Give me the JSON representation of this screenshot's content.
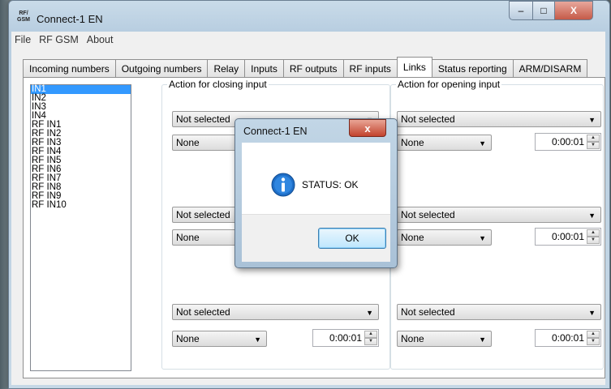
{
  "window": {
    "title": "Connect-1 EN",
    "app_icon_text": "RF/ GSM"
  },
  "menu": [
    "File",
    "RF GSM",
    "About"
  ],
  "tabs": [
    "Incoming numbers",
    "Outgoing numbers",
    "Relay",
    "Inputs",
    "RF outputs",
    "RF inputs",
    "Links",
    "Status reporting",
    "ARM/DISARM"
  ],
  "active_tab": "Links",
  "inputs_list": [
    "IN1",
    "IN2",
    "IN3",
    "IN4",
    "RF IN1",
    "RF IN2",
    "RF IN3",
    "RF IN4",
    "RF IN5",
    "RF IN6",
    "RF IN7",
    "RF IN8",
    "RF IN9",
    "RF IN10"
  ],
  "selected_input": "IN1",
  "closing_group": {
    "title": "Action for closing input",
    "rows": [
      {
        "action": "Not selected",
        "target": "None",
        "time": ""
      },
      {
        "action": "Not selected",
        "target": "None",
        "time": ""
      },
      {
        "action": "Not selected",
        "target": "None",
        "time": "0:00:01"
      }
    ]
  },
  "opening_group": {
    "title": "Action for opening input",
    "rows": [
      {
        "action": "Not selected",
        "target": "None",
        "time": "0:00:01"
      },
      {
        "action": "Not selected",
        "target": "None",
        "time": "0:00:01"
      },
      {
        "action": "Not selected",
        "target": "None",
        "time": "0:00:01"
      }
    ]
  },
  "dialog": {
    "title": "Connect-1 EN",
    "message": "STATUS: OK",
    "ok_label": "OK",
    "close_glyph": "x"
  },
  "caption": {
    "min": "–",
    "max": "□",
    "close": "X"
  }
}
